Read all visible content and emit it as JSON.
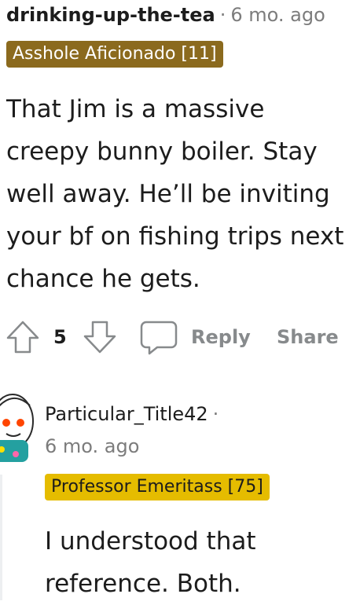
{
  "comment1": {
    "username": "drinking-up-the-tea",
    "separator": "·",
    "timestamp": "6 mo. ago",
    "flair": "Asshole Aficionado [11]",
    "body": "That Jim is a massive creepy bunny boiler. Stay well away. He’ll be inviting your bf on fishing trips next chance he gets.",
    "score": "5",
    "reply_label": "Reply",
    "share_label": "Share",
    "icons": [
      "upvote-icon",
      "downvote-icon",
      "comment-icon"
    ]
  },
  "comment2": {
    "username": "Particular_Title42",
    "separator": "·",
    "timestamp": "6 mo. ago",
    "flair": "Professor Emeritass [75]",
    "body": "I understood that reference. Both.",
    "avatar_icon": "snoo-avatar-icon"
  },
  "colors": {
    "flair1_bg": "#8b6a1e",
    "flair2_bg": "#e5bc00",
    "muted_text": "#7c7c7c",
    "action_text": "#878a8c"
  }
}
